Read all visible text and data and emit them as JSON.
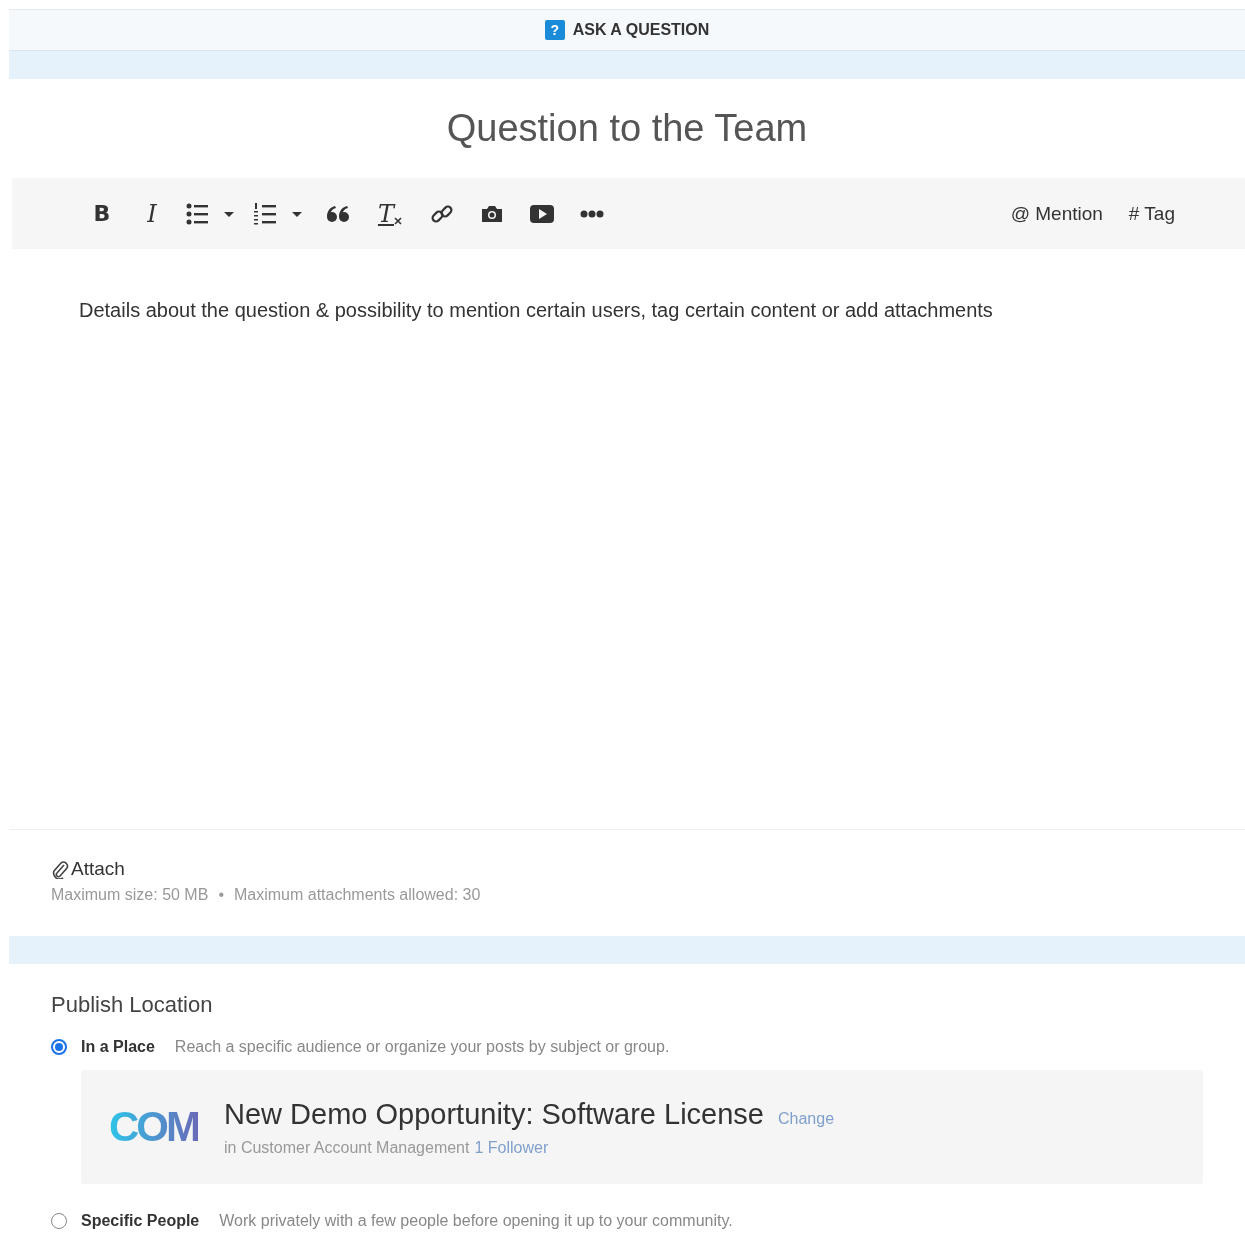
{
  "header": {
    "title": "ASK A QUESTION",
    "icon_text": "?"
  },
  "title": "Question to the Team",
  "toolbar": {
    "items": [
      {
        "kind": "bold",
        "label": "B"
      },
      {
        "kind": "italic",
        "label": "I"
      },
      {
        "kind": "bullets"
      },
      {
        "kind": "numbers"
      },
      {
        "kind": "quote"
      },
      {
        "kind": "clear",
        "label": "T"
      },
      {
        "kind": "link"
      },
      {
        "kind": "camera"
      },
      {
        "kind": "video"
      },
      {
        "kind": "more"
      }
    ],
    "right": [
      "@ Mention",
      "# Tag"
    ]
  },
  "body": "Details about the question & possibility to mention certain users, tag certain content or add attachments",
  "attach": {
    "label": "Attach",
    "max_size": "Maximum size: 50 MB",
    "separator": "•",
    "max_count": "Maximum attachments allowed: 30"
  },
  "publish": {
    "heading": "Publish Location",
    "options": [
      {
        "label": "In a Place",
        "description": "Reach a specific audience or organize your posts by subject or group.",
        "selected": true
      },
      {
        "label": "Specific People",
        "description": "Work privately with a few people before opening it up to your community.",
        "selected": false
      }
    ],
    "place": {
      "logo_text": "COM",
      "name": "New Demo Opportunity: Software License",
      "change": "Change",
      "parent": "in Customer Account Management",
      "followers": "1 Follower"
    }
  }
}
